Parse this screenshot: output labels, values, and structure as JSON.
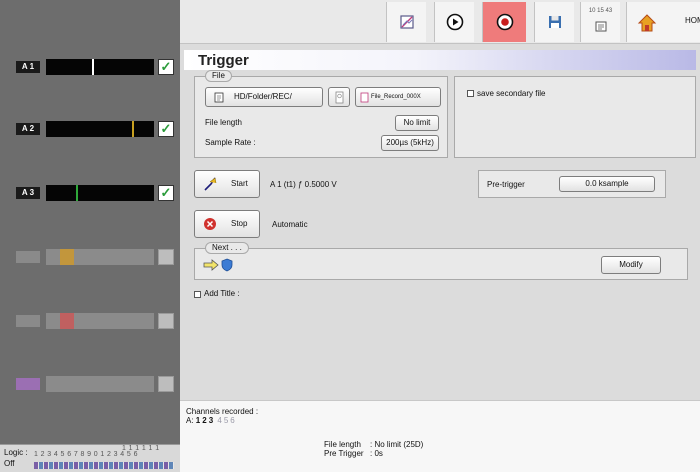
{
  "toolbar": {
    "time": "10 15 43",
    "home_label": "HOME",
    "colors": {
      "record_active": "#ef7b7b"
    }
  },
  "channels": [
    {
      "label": "A 1",
      "active": true,
      "checked": true,
      "trace_color": "#ffffff"
    },
    {
      "label": "A 2",
      "active": true,
      "checked": true,
      "trace_color": "#c8a020"
    },
    {
      "label": "A 3",
      "active": true,
      "checked": true,
      "trace_color": "#2fa83a"
    },
    {
      "label": "",
      "active": false,
      "checked": false,
      "trace_color": "#c2963c"
    },
    {
      "label": "",
      "active": false,
      "checked": false,
      "trace_color": "#c06060"
    },
    {
      "label": "",
      "active": false,
      "checked": false,
      "trace_color": "#9b6fb3"
    }
  ],
  "logic": {
    "label": "Logic :",
    "state": "Off",
    "numbers_top": "1 1 1 1 1 1",
    "numbers": "1 2 3 4 5 6 7 8 9 0 1 2 3 4 5 6"
  },
  "dialog": {
    "title": "Trigger",
    "file": {
      "legend": "File",
      "path": "HD/Folder/REC/",
      "record_name": "File_Record_000X",
      "file_length_label": "File length",
      "file_length_value": "No limit",
      "sample_rate_label": "Sample Rate :",
      "sample_rate_value": "200µs (5kHz)"
    },
    "secondary": {
      "label": "save secondary file",
      "checked": false
    },
    "start": {
      "label": "Start",
      "condition": "A 1 (t1) ƒ 0.5000 V"
    },
    "pretrigger": {
      "label": "Pre-trigger",
      "value": "0.0 ksample"
    },
    "stop": {
      "label": "Stop",
      "condition": "Automatic"
    },
    "next": {
      "legend": "Next . . .",
      "modify_label": "Modify"
    },
    "add_title": {
      "label": "Add Title :",
      "checked": false
    }
  },
  "footer": {
    "channels_label": "Channels recorded :",
    "channels_prefix": "A:",
    "channels_active": [
      "1",
      "2",
      "3"
    ],
    "channels_inactive": [
      "4",
      "5",
      "6"
    ],
    "file_length_label": "File length",
    "file_length_value": ": No limit (25D)",
    "pretrigger_label": "Pre Trigger",
    "pretrigger_value": ": 0s"
  }
}
